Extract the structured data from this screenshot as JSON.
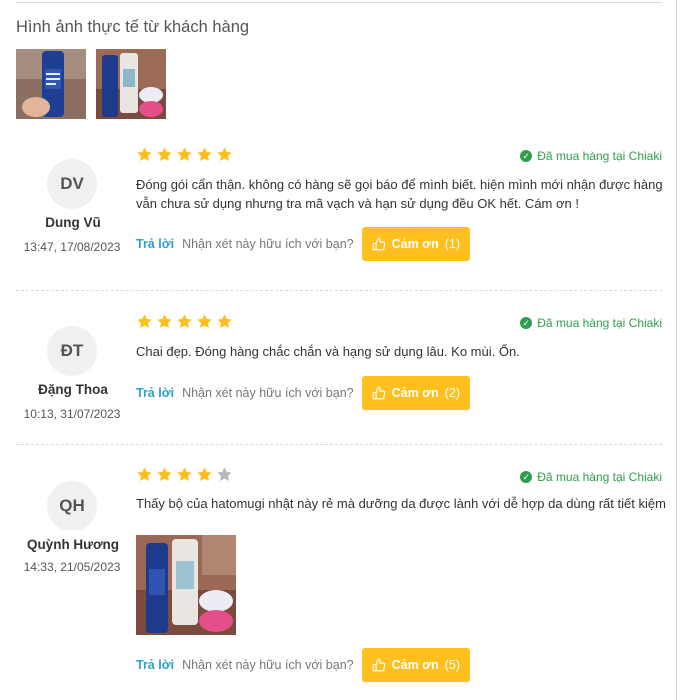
{
  "section_title": "Hình ảnh thực tế từ khách hàng",
  "verified_label": "Đã mua hàng tại Chiaki",
  "reply_label": "Trả lời",
  "useful_question": "Nhận xét này hữu ích với bạn?",
  "thanks_label": "Cảm ơn",
  "colors": {
    "star_active": "#ffbf1f",
    "star_inactive": "#b8b8b8",
    "accent_blue": "#2a9fd6",
    "verified_green": "#2e9e4a",
    "button_bg": "#ffbf1f"
  },
  "reviews": [
    {
      "initials": "DV",
      "name": "Dung Vũ",
      "date": "13:47, 17/08/2023",
      "rating": 5,
      "content": "  Đóng gói cẩn thận. không có hàng  sẽ gọi báo để mình biết. hiện mình mới nhận được hàng vẫn chưa sử dụng nhưng tra mã vạch và hạn sử dụng đều OK hết. Cám ơn !",
      "thanks_count": "(1)"
    },
    {
      "initials": "ĐT",
      "name": "Đặng Thoa",
      "date": "10:13, 31/07/2023",
      "rating": 5,
      "content": "Chai đẹp. Đóng hàng chắc chắn và hạng sử dụng lâu. Ko mùi. Ổn.",
      "thanks_count": "(2)"
    },
    {
      "initials": "QH",
      "name": "Quỳnh Hương",
      "date": "14:33, 21/05/2023",
      "rating": 4,
      "content": "Thấy bộ của hatomugi nhật này rẻ mà dưỡng da được lành với dễ hợp da dùng rất tiết kiệm",
      "thanks_count": "(5)"
    }
  ]
}
